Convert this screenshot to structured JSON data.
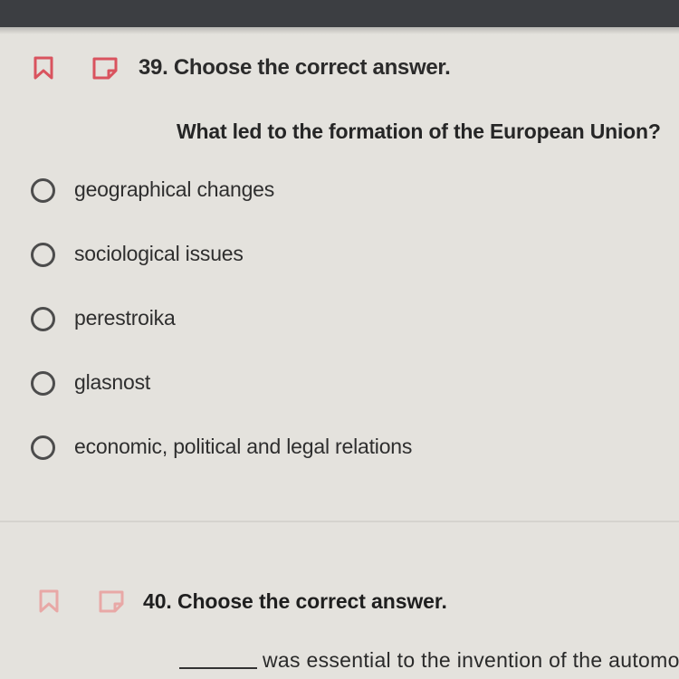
{
  "questions": [
    {
      "title": "39. Choose the correct answer.",
      "prompt": "What led to the formation of the European Union?",
      "options": [
        "geographical changes",
        "sociological issues",
        "perestroika",
        "glasnost",
        "economic, political and legal relations"
      ]
    },
    {
      "title": "40. Choose the correct answer.",
      "prompt_blank": "_______",
      "prompt": "was essential to the invention of the automo"
    }
  ],
  "colors": {
    "accent_red": "#d9535e",
    "accent_red_faded": "#e8a8a6",
    "radio_border": "#4c4c4c",
    "background": "#e4e2dd"
  }
}
